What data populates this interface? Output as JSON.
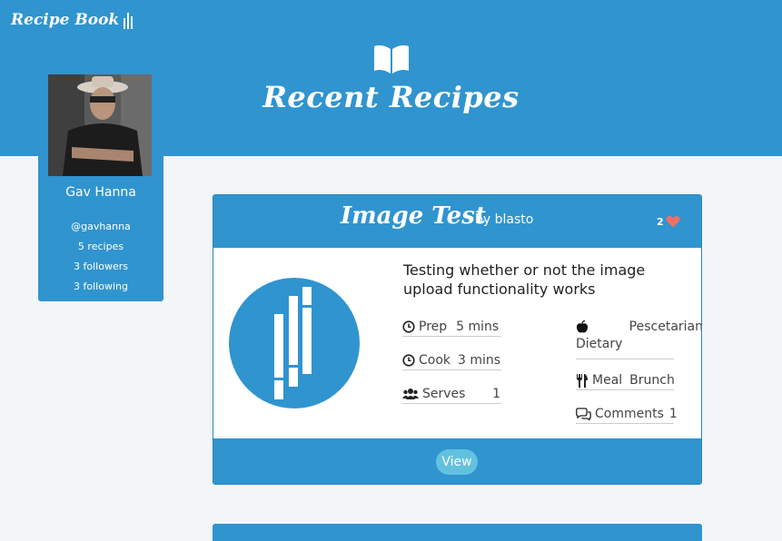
{
  "nav": {
    "brand": "Recipe Book"
  },
  "hero": {
    "icon": "open-book-icon",
    "title": "Recent Recipes"
  },
  "profile": {
    "name": "Gav Hanna",
    "handle": "@gavhanna",
    "recipes": "5 recipes",
    "followers": "3 followers",
    "following": "3 following"
  },
  "recipe": {
    "title": "Image Test",
    "author": "by blasto",
    "likes": "2",
    "description": "Testing whether or not the image upload functionality works",
    "prep_label": "Prep",
    "prep_value": "5 mins",
    "cook_label": "Cook",
    "cook_value": "3 mins",
    "serves_label": "Serves",
    "serves_value": "1",
    "dietary_value": "Pescetarian",
    "dietary_label": "Dietary",
    "meal_label": "Meal",
    "meal_value": "Brunch",
    "comments_label": "Comments",
    "comments_value": "1",
    "view_label": "View"
  },
  "colors": {
    "primary": "#3094cf",
    "button": "#63c1e0",
    "heart": "#f07068",
    "page_bg": "#f2f6f9"
  }
}
